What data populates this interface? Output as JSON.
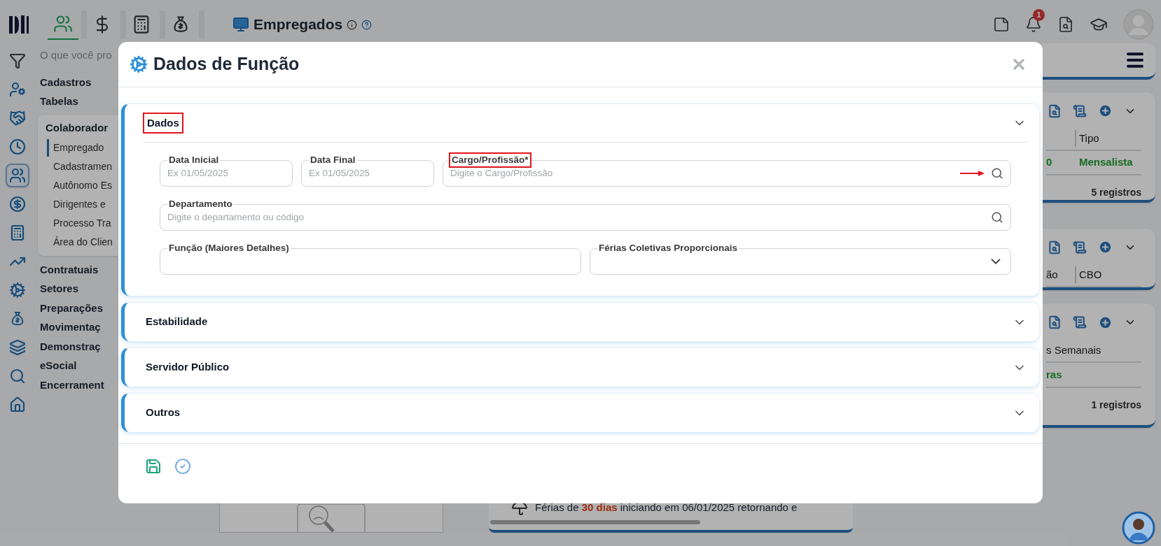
{
  "top_bar": {
    "modules": [
      {
        "kind": "people",
        "selected": true
      },
      {
        "kind": "dollar",
        "selected": false
      },
      {
        "kind": "calculator",
        "selected": false
      },
      {
        "kind": "money-bag",
        "selected": false
      }
    ],
    "title": "Empregados",
    "notification_count": "1"
  },
  "rail": [
    {
      "kind": "filter",
      "selected": false
    },
    {
      "kind": "user-gear",
      "selected": false
    },
    {
      "kind": "handshake",
      "selected": false
    },
    {
      "kind": "clock",
      "selected": false
    },
    {
      "kind": "people",
      "selected": true
    },
    {
      "kind": "dollar",
      "selected": false
    },
    {
      "kind": "calculator",
      "selected": false
    },
    {
      "kind": "trend",
      "selected": false
    },
    {
      "kind": "gear",
      "selected": false
    },
    {
      "kind": "money-bag",
      "selected": false
    },
    {
      "kind": "layers",
      "selected": false
    },
    {
      "kind": "search",
      "selected": false
    },
    {
      "kind": "home",
      "selected": false
    }
  ],
  "search": {
    "placeholder": "O que você pro"
  },
  "menu": [
    {
      "label": "Cadastros"
    },
    {
      "label": "Tabelas"
    },
    {
      "label": "Colaborador",
      "children": [
        {
          "label": "Empregado",
          "selected": true
        },
        {
          "label": "Cadastramen",
          "selected": false
        },
        {
          "label": "Autônomo Es",
          "selected": false
        },
        {
          "label": "Dirigentes e",
          "selected": false
        },
        {
          "label": "Processo Tra",
          "selected": false
        },
        {
          "label": "Área do Clien",
          "selected": false
        }
      ]
    },
    {
      "label": "Contratuais"
    },
    {
      "label": "Setores"
    },
    {
      "label": "Preparações"
    },
    {
      "label": "Movimentaç"
    },
    {
      "label": "Demonstraç"
    },
    {
      "label": "eSocial"
    },
    {
      "label": "Encerrament"
    }
  ],
  "cards": [
    {
      "columns": [
        "",
        "Tipo"
      ],
      "values": [
        "0",
        "Mensalista"
      ],
      "footer": "5 registros"
    },
    {
      "columns": [
        "ão",
        "CBO"
      ]
    },
    {
      "columns": [
        "s Semanais"
      ],
      "values": [
        "ras"
      ],
      "footer": "1 registros"
    }
  ],
  "notice": "Férias de **30 dias** iniciando em 06/01/2025 retornando e",
  "modal": {
    "title": "Dados de Função",
    "sections": [
      {
        "title": "Dados",
        "expanded": true,
        "highlighted": true,
        "rows": [
          [
            {
              "kind": "date",
              "label": "Data Inicial",
              "placeholder": "Ex 01/05/2025",
              "highlighted": false
            },
            {
              "kind": "date",
              "label": "Data Final",
              "placeholder": "Ex 01/05/2025",
              "highlighted": false
            },
            {
              "kind": "search",
              "label": "Cargo/Profissão*",
              "placeholder": "Digite o Cargo/Profissão",
              "highlighted": true,
              "arrow": true
            }
          ],
          [
            {
              "kind": "search",
              "label": "Departamento",
              "placeholder": "Digite o departamento ou código",
              "highlighted": false
            }
          ],
          [
            {
              "kind": "text",
              "label": "Função (Maiores Detalhes)",
              "highlighted": false
            },
            {
              "kind": "select",
              "label": "Férias Coletivas Proporcionais",
              "highlighted": false
            }
          ]
        ]
      },
      {
        "title": "Estabilidade",
        "expanded": false,
        "highlighted": false
      },
      {
        "title": "Servidor Público",
        "expanded": false,
        "highlighted": false
      },
      {
        "title": "Outros",
        "expanded": false,
        "highlighted": false
      }
    ]
  }
}
